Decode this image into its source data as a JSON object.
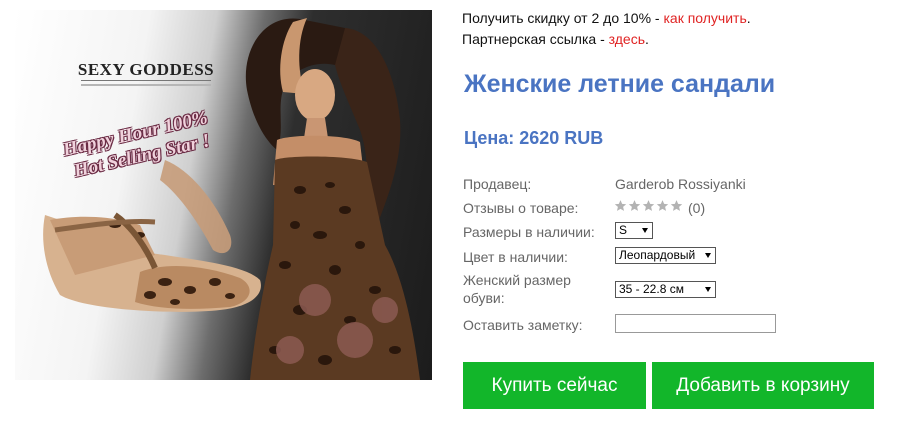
{
  "promo": {
    "discount_text": "Получить скидку от 2 до 10% - ",
    "discount_link": "как получить",
    "discount_suffix": ".",
    "partner_text": "Партнерская ссылка - ",
    "partner_link": "здесь",
    "partner_suffix": "."
  },
  "image": {
    "brand": "SEXY GODDESS",
    "promo_line_1": "Happy Hour 100%",
    "promo_line_2": "Hot Selling Star !"
  },
  "product": {
    "title": "Женские летние сандали",
    "price": "Цена: 2620 RUB"
  },
  "attributes": {
    "seller_label": "Продавец:",
    "seller_value": "Garderob Rossiyanki",
    "reviews_label": "Отзывы о товаре:",
    "reviews_count": "(0)",
    "rating_stars": 0,
    "sizes_label": "Размеры в наличии:",
    "sizes_selected": "S",
    "color_label": "Цвет в наличии:",
    "color_selected": "Леопардовый",
    "shoe_size_label_1": "Женский размер",
    "shoe_size_label_2": "обуви:",
    "shoe_size_selected": "35 - 22.8 см",
    "note_label": "Оставить заметку:",
    "note_value": ""
  },
  "buttons": {
    "buy": "Купить сейчас",
    "cart": "Добавить в корзину"
  },
  "colors": {
    "accent": "#4a74c2",
    "link": "#e02424",
    "button": "#12b62a",
    "star_empty": "#b3b3b3"
  }
}
